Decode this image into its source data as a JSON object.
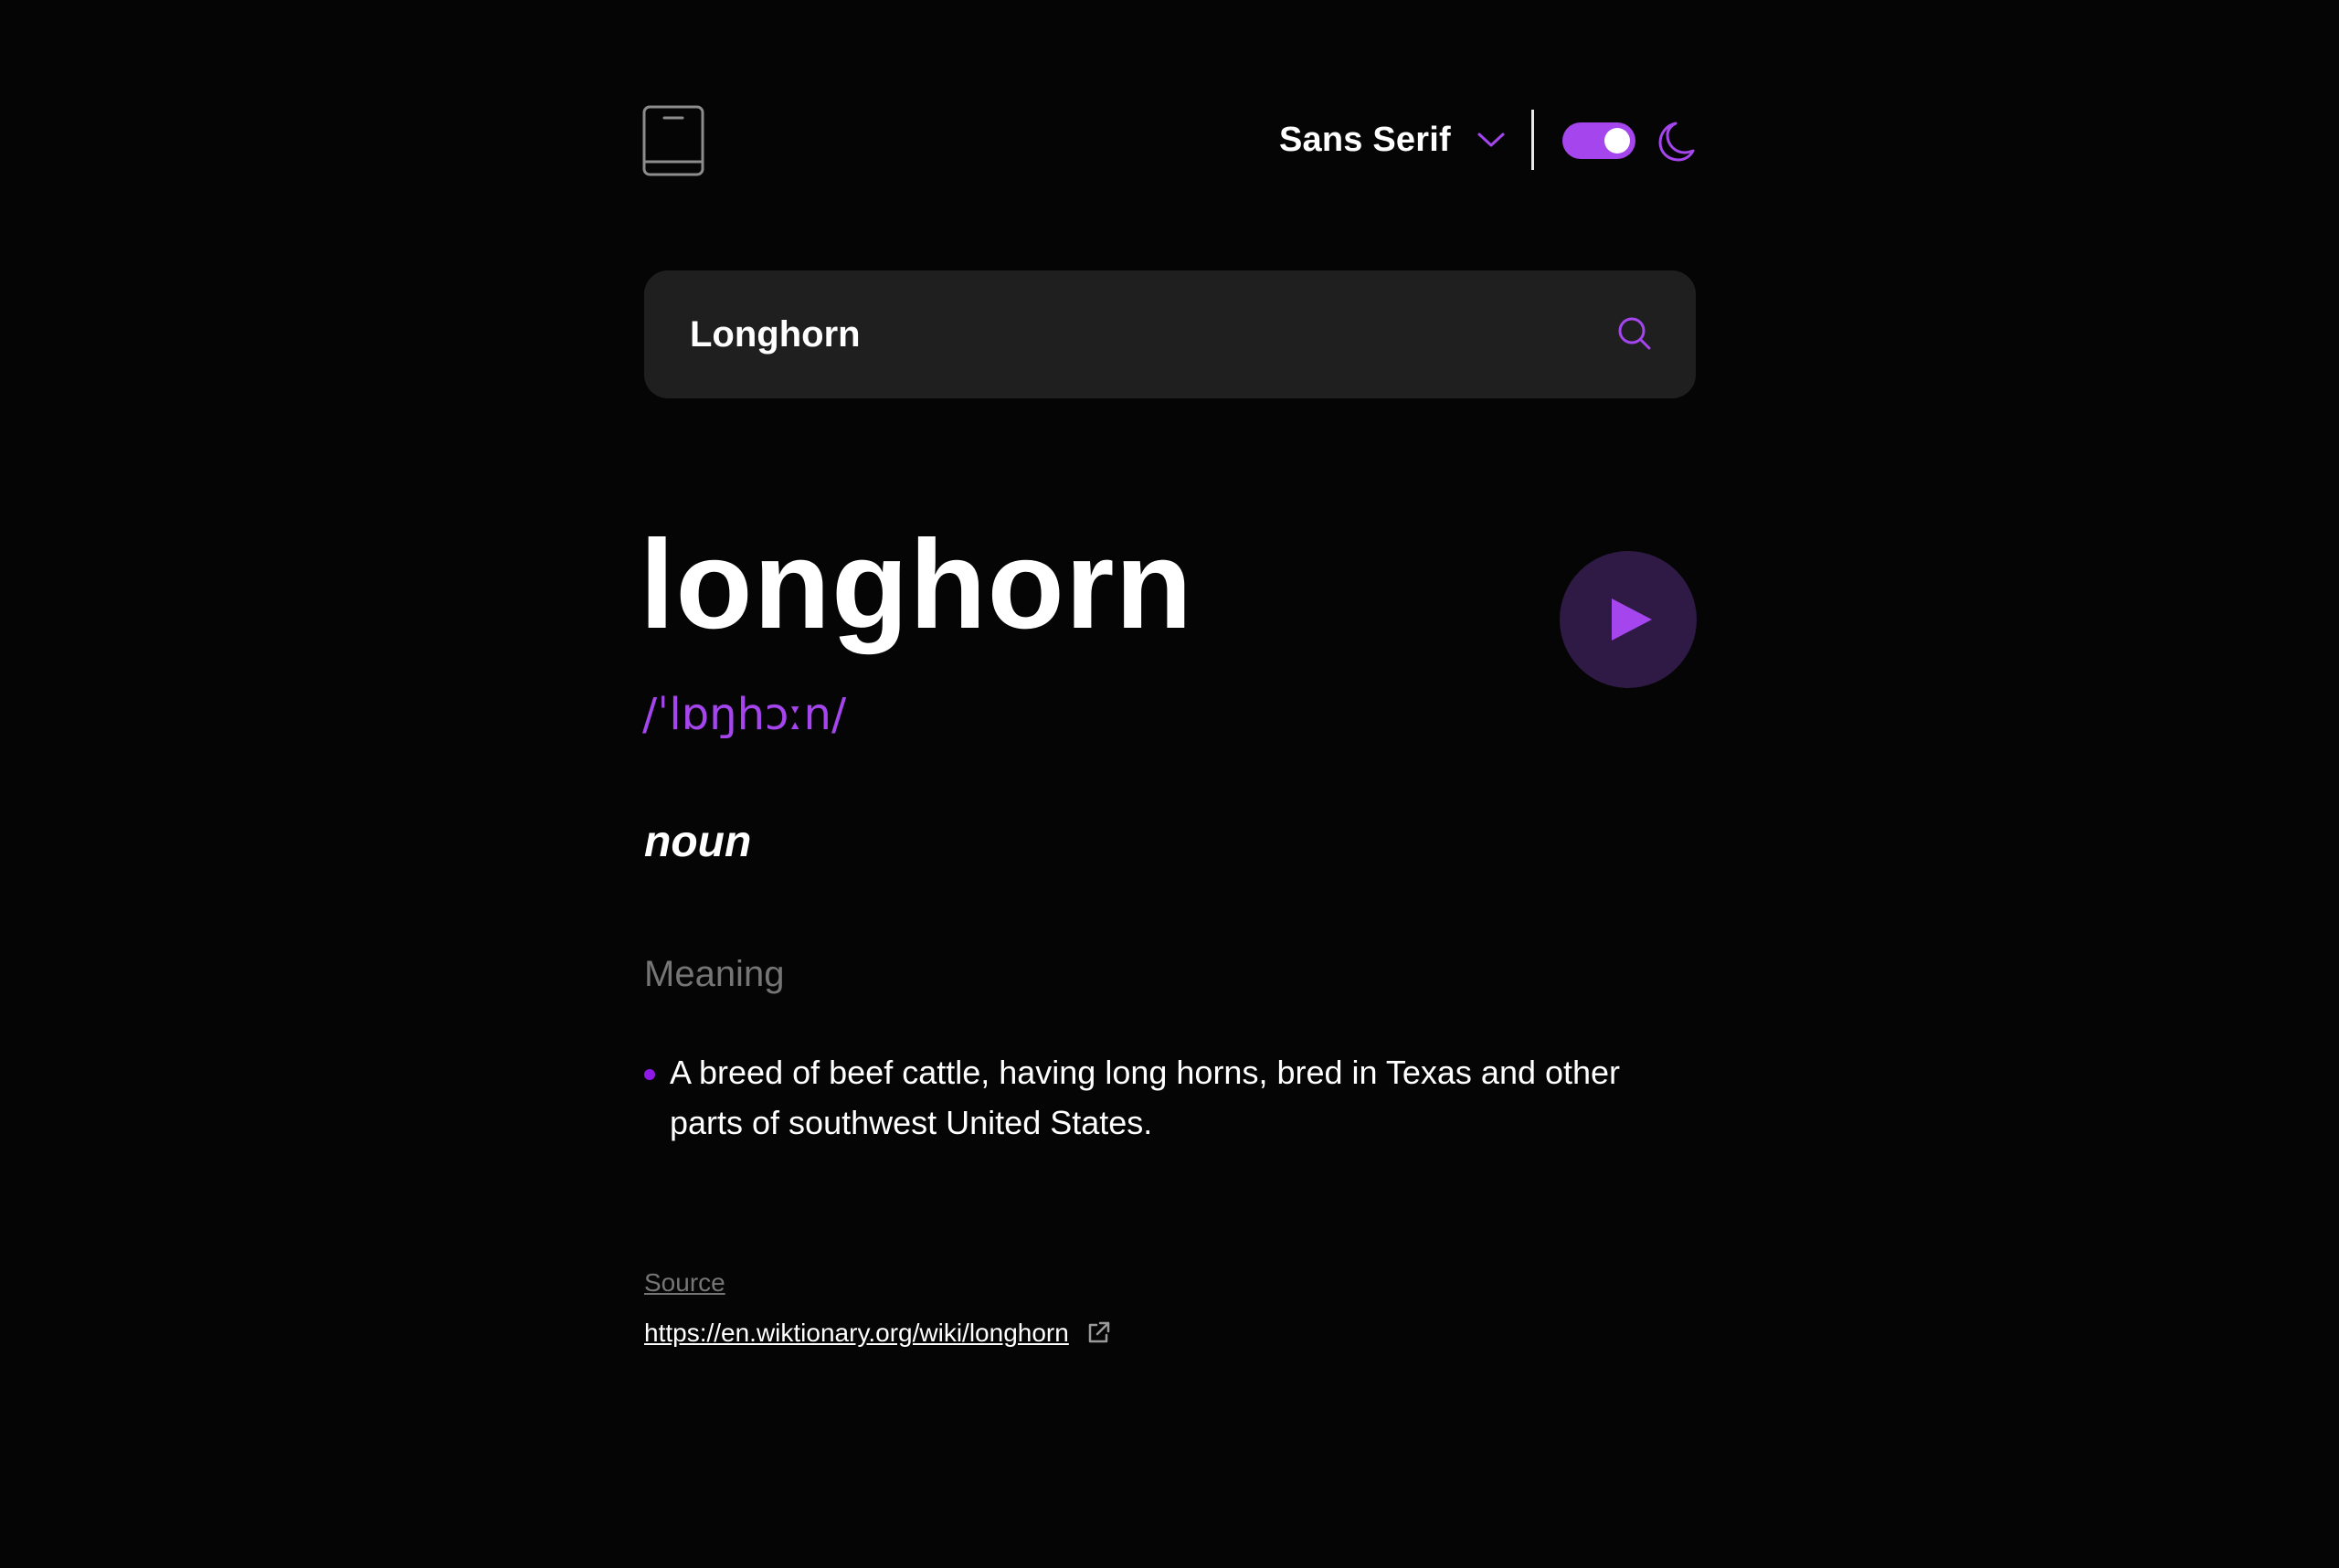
{
  "header": {
    "logo_icon": "book-icon",
    "font_selector": {
      "selected": "Sans Serif",
      "icon": "chevron-down-icon"
    },
    "theme_toggle": {
      "state": "on",
      "icon": "moon-icon"
    }
  },
  "search": {
    "value": "Longhorn",
    "icon": "search-icon"
  },
  "entry": {
    "word": "longhorn",
    "phonetic": "/ˈlɒŋhɔːn/",
    "play_icon": "play-icon",
    "part_of_speech": "noun",
    "meaning_heading": "Meaning",
    "definitions": [
      "A breed of beef cattle, having long horns, bred in Texas and other parts of southwest United States."
    ]
  },
  "source": {
    "label": "Source",
    "url": "https://en.wiktionary.org/wiki/longhorn",
    "icon": "external-link-icon"
  },
  "colors": {
    "background": "#050505",
    "accent": "#a445ed",
    "search_bg": "#1f1f1f",
    "muted_text": "#757575",
    "play_bg": "#2e1a44"
  }
}
